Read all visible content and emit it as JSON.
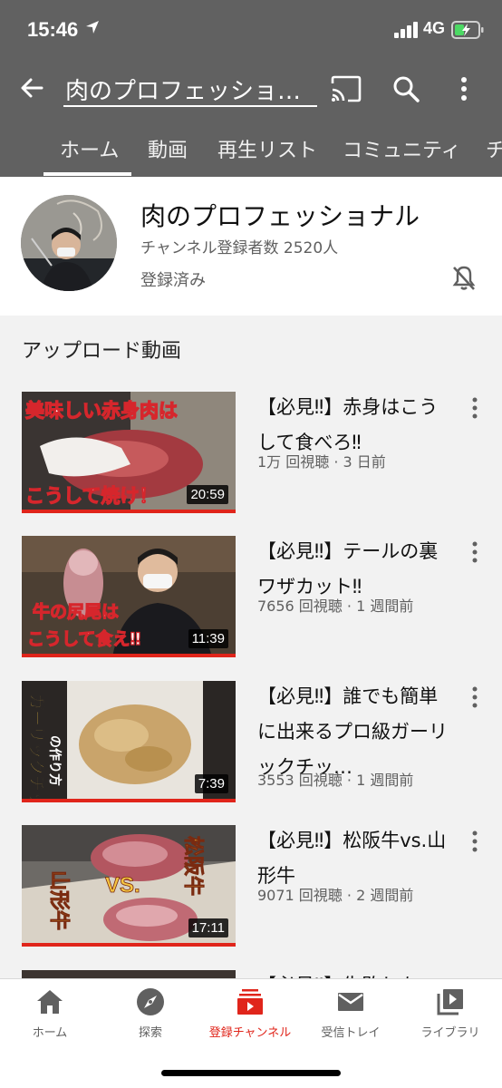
{
  "status_bar": {
    "time": "15:46",
    "network": "4G"
  },
  "app_bar": {
    "title": "肉のプロフェッショ…"
  },
  "tabs": [
    {
      "label": "ホーム"
    },
    {
      "label": "動画"
    },
    {
      "label": "再生リスト"
    },
    {
      "label": "コミュニティ"
    },
    {
      "label": "チ"
    }
  ],
  "channel": {
    "name": "肉のプロフェッショナル",
    "subscribers": "チャンネル登録者数 2520人",
    "status": "登録済み"
  },
  "section_title": "アップロード動画",
  "videos": [
    {
      "title": "【必見‼】赤身はこうして食べろ‼",
      "meta": "1万 回視聴 · 3 日前",
      "duration": "20:59",
      "overlay_top": "美味しい赤身肉は",
      "overlay_bottom": "こうして焼け！"
    },
    {
      "title": "【必見‼】テールの裏ワザカット‼",
      "meta": "7656 回視聴 · 1 週間前",
      "duration": "11:39",
      "overlay_top": "牛の尻尾は",
      "overlay_bottom": "こうして食え‼"
    },
    {
      "title": "【必見‼】誰でも簡単に出来るプロ級ガーリックチッ…",
      "meta": "3553 回視聴 · 1 週間前",
      "duration": "7:39",
      "overlay_top": "ガーリックチップ",
      "overlay_bottom": "の作り方"
    },
    {
      "title": "【必見‼】松阪牛vs.山形牛",
      "meta": "9071 回視聴 · 2 週間前",
      "duration": "17:11",
      "overlay_top": "松阪牛",
      "overlay_bottom": "山形牛"
    },
    {
      "title": "【必見‼】失敗しな",
      "meta": "",
      "duration": ""
    }
  ],
  "bottom_nav": [
    {
      "label": "ホーム",
      "icon": "home-icon"
    },
    {
      "label": "探索",
      "icon": "compass-icon"
    },
    {
      "label": "登録チャンネル",
      "icon": "subscriptions-icon",
      "active": true
    },
    {
      "label": "受信トレイ",
      "icon": "inbox-icon"
    },
    {
      "label": "ライブラリ",
      "icon": "library-icon"
    }
  ],
  "colors": {
    "appbar": "#616161",
    "accent": "#e0251b"
  }
}
